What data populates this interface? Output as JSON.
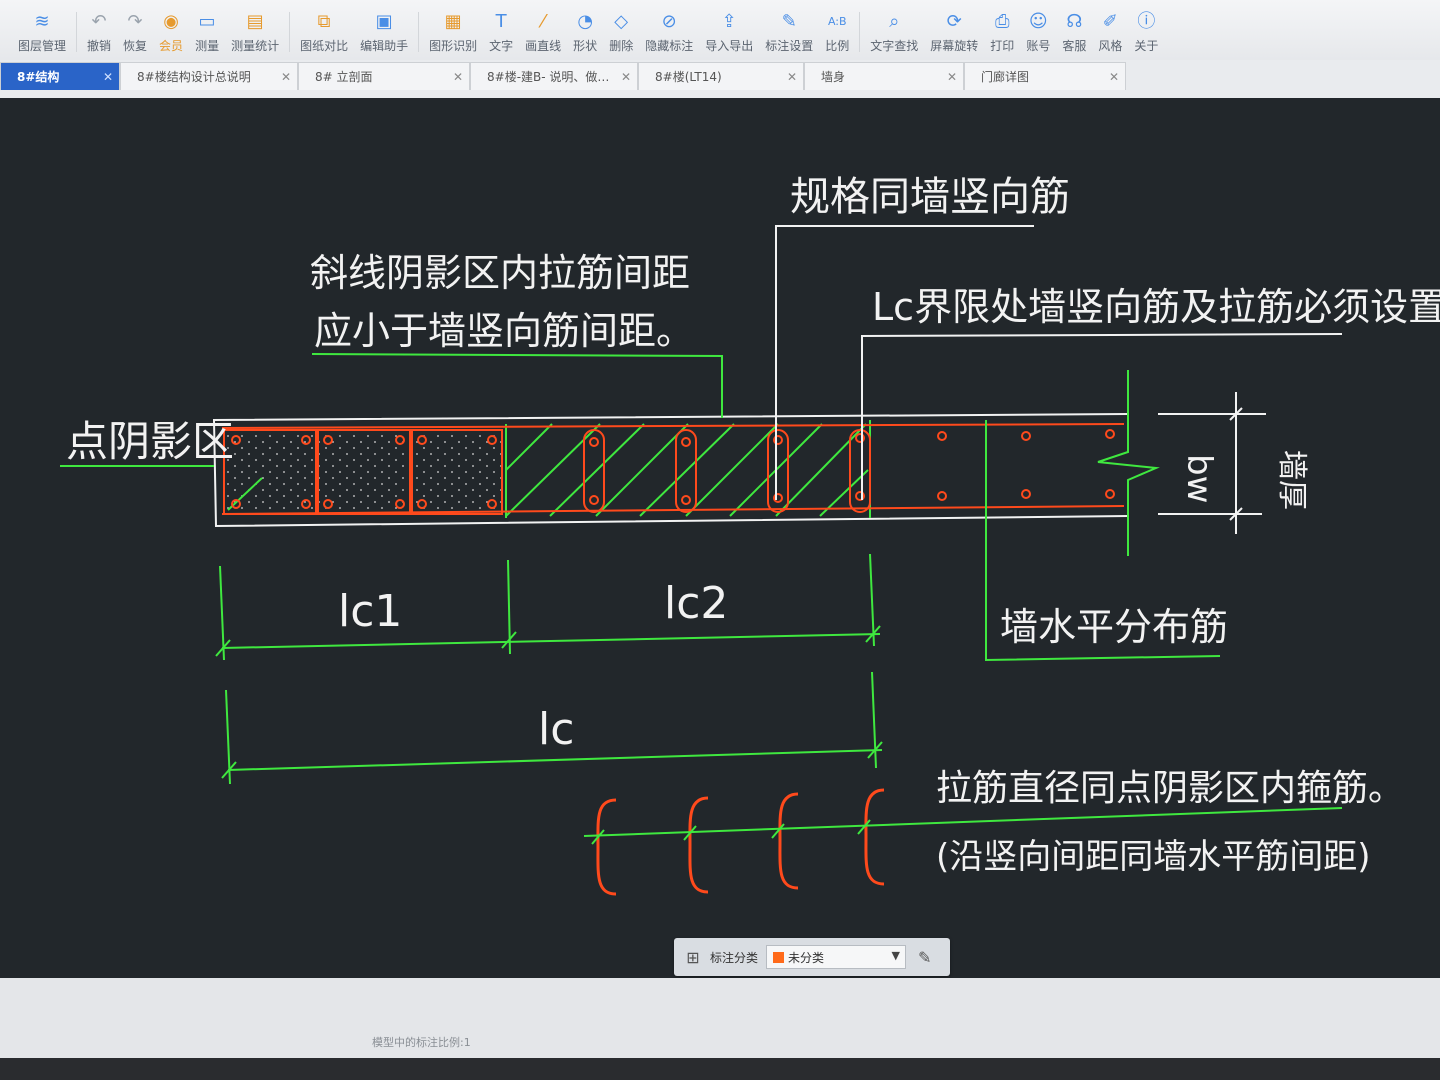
{
  "toolbar": {
    "items": [
      {
        "label": "图层管理",
        "icon": "layers-icon"
      },
      {
        "label": "撤销",
        "icon": "undo-icon"
      },
      {
        "label": "恢复",
        "icon": "redo-icon"
      },
      {
        "label": "会员",
        "icon": "vip-icon"
      },
      {
        "label": "测量",
        "icon": "ruler-icon"
      },
      {
        "label": "测量统计",
        "icon": "measure-stats-icon"
      },
      {
        "label": "图纸对比",
        "icon": "compare-icon"
      },
      {
        "label": "编辑助手",
        "icon": "edit-assistant-icon"
      },
      {
        "label": "图形识别",
        "icon": "shape-recognition-icon"
      },
      {
        "label": "文字",
        "icon": "text-icon"
      },
      {
        "label": "画直线",
        "icon": "line-icon"
      },
      {
        "label": "形状",
        "icon": "shape-icon"
      },
      {
        "label": "删除",
        "icon": "eraser-icon"
      },
      {
        "label": "隐藏标注",
        "icon": "hide-annotation-icon"
      },
      {
        "label": "导入导出",
        "icon": "import-export-icon"
      },
      {
        "label": "标注设置",
        "icon": "annotation-settings-icon"
      },
      {
        "label": "比例",
        "icon": "scale-icon"
      },
      {
        "label": "文字查找",
        "icon": "text-search-icon"
      },
      {
        "label": "屏幕旋转",
        "icon": "screen-rotate-icon"
      },
      {
        "label": "打印",
        "icon": "print-icon"
      },
      {
        "label": "账号",
        "icon": "account-icon"
      },
      {
        "label": "客服",
        "icon": "support-icon"
      },
      {
        "label": "风格",
        "icon": "style-icon"
      },
      {
        "label": "关于",
        "icon": "about-icon"
      }
    ]
  },
  "tabs": [
    {
      "label": "8#结构",
      "active": true
    },
    {
      "label": "8#楼结构设计总说明",
      "active": false
    },
    {
      "label": "8# 立剖面",
      "active": false
    },
    {
      "label": "8#楼-建B- 说明、做…",
      "active": false
    },
    {
      "label": "8#楼(LT14)",
      "active": false
    },
    {
      "label": "墙身",
      "active": false
    },
    {
      "label": "门廊详图",
      "active": false
    }
  ],
  "drawing": {
    "callout_spec": "规格同墙竖向筋",
    "callout_hatch_line1": "斜线阴影区内拉筋间距",
    "callout_hatch_line2": "应小于墙竖向筋间距。",
    "callout_lc": "Lc界限处墙竖向筋及拉筋必须设置",
    "label_dot_zone": "点阴影区",
    "label_bw": "bw",
    "label_wall_thickness": "墙厚",
    "label_horizontal_bar": "墙水平分布筋",
    "dim_lc1": "lc1",
    "dim_lc2": "lc2",
    "dim_lc": "lc",
    "note_line1": "拉筋直径同点阴影区内箍筋。",
    "note_line2": "(沿竖向间距同墙水平筋间距)"
  },
  "classify_bar": {
    "label": "标注分类",
    "selected": "未分类",
    "swatch_color": "#ff6a1a"
  },
  "status": {
    "scale_text": "模型中的标注比例:1"
  },
  "colors": {
    "toolbar_bg": "#eef0f2",
    "tab_active": "#2a64c8",
    "canvas_bg": "#22272b",
    "cad_green": "#3fe83f",
    "cad_red": "#ff4a1c",
    "cad_white": "#f2f2f2"
  }
}
